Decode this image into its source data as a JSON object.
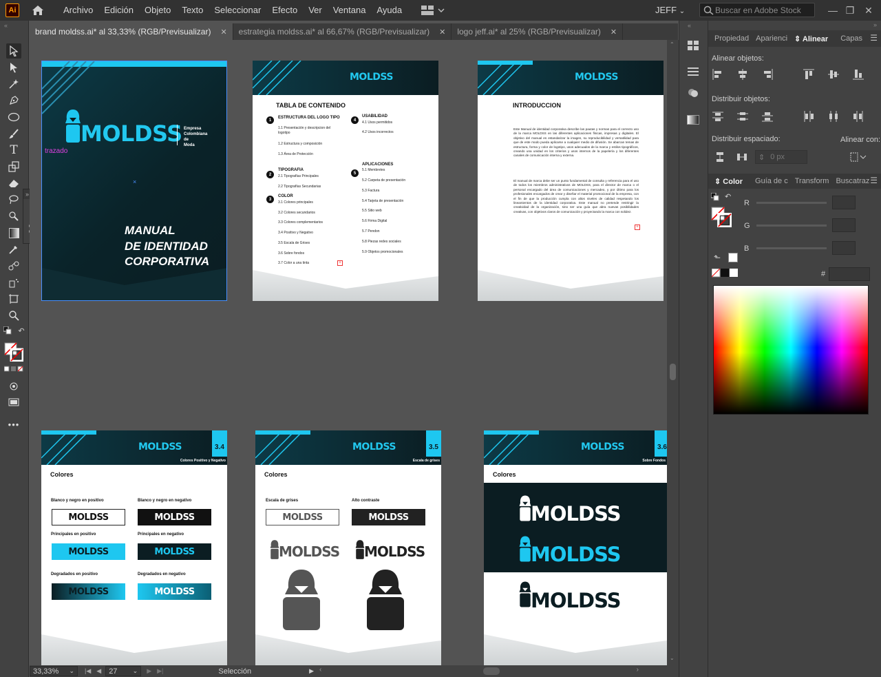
{
  "app": {
    "logo": "Ai",
    "user": "JEFF",
    "stock_search_placeholder": "Buscar en Adobe Stock"
  },
  "menu": [
    "Archivo",
    "Edición",
    "Objeto",
    "Texto",
    "Seleccionar",
    "Efecto",
    "Ver",
    "Ventana",
    "Ayuda"
  ],
  "tabs": [
    {
      "label": "brand moldss.ai* al 33,33% (RGB/Previsualizar)",
      "close": "✕"
    },
    {
      "label": "estrategia moldss.ai* al 66,67% (RGB/Previsualizar)",
      "close": "✕"
    },
    {
      "label": "logo jeff.ai* al 25% (RGB/Previsualizar)",
      "close": "✕"
    }
  ],
  "canvas": {
    "path_hint": "trazado",
    "cover": {
      "brand": "MOLDSS",
      "tagline": "Empresa\nColombiana\nde\nModa",
      "title1": "MANUAL",
      "title2": "DE IDENTIDAD",
      "title3": "CORPORATIVA"
    },
    "toc": {
      "brand": "MOLDSS",
      "title": "TABLA DE CONTENIDO",
      "s1": "ESTRUCTURA DEL LOGO TIPO",
      "s1_items": [
        "1.1 Presentación y descripcion del logotipo",
        "1.2 Estructura y composición",
        "1.3 Área de Protección"
      ],
      "s2": "TIPOGRAFIA",
      "s2_items": [
        "2.1 Tipografías Principales",
        "2.2 Tipografías Secundarias"
      ],
      "s3": "COLOR",
      "s3_items": [
        "3.1 Colores principales",
        "3.2 Colores secundarios",
        "3.3 Colores complementarios",
        "3.4 Positivo y Negativo",
        "3.5 Escala de Grises",
        "3.6 Sobre fondos",
        "3.7 Color a una tinta"
      ],
      "s4": "USABILIDAD",
      "s4_items": [
        "4.1 Usos permitidos",
        "4.2 Usos incorrectos"
      ],
      "s5": "APLICACIONES",
      "s5_items": [
        "5.1 Membretes",
        "5.2 Carpeta de presentación",
        "5.3 Factura",
        "5.4 Tarjeta de presentación",
        "5.5 Sitio web",
        "5.6 Firma Digital",
        "5.7 Pendon",
        "5.8 Piezas redes sociales",
        "5.9 Objetos promocionales"
      ],
      "nums": [
        "1",
        "2",
        "3",
        "4",
        "5"
      ]
    },
    "intro": {
      "brand": "MOLDSS",
      "title": "INTRODUCCION",
      "p1": "Este Manual de identidad corporativa describe las pautas y normas para el correcto uso de la marca MOLDSS en las diferentes aplicaciones físicas, impresas y digitales. El objetivo del manual es estandarizar la imagen, su reproducibilidad y versatilidad para que de este modo pueda aplicarse a cualquier medio de difusión. Se abarcan temas de estructura, forma y color de logotipo, usos adecuados de la marca y estilos tipográficos, creando una unidad en los criterios y usos internos de la papelería y los diferentes canales de comunicación interna y externa.",
      "p2": "El manual de marca debe ser un punto fundamental de consulta y referencia para el uso de todos los miembros administrativos de MOLDSS, para el director de marca o el personal encargado del área de comunicaciones y mercadeo, y por último para los profesionales encargados de crear y diseñar el material promocional de la empresa, con el fin de que la producción cumpla con altos niveles de calidad respetando los lineamientos de la identidad corporativa. Este manual no pretende restringir la creatividad de la organización, sino ser una guía que abra nuevas posibilidades creativas, con objetivos claros de comunicación y proyectando la marca con solidez."
    },
    "p34": {
      "brand": "MOLDSS",
      "num": "3.4",
      "sub": "Colores Positivo y Negativo",
      "section": "Colores",
      "l1": "Blanco y negro en positivo",
      "l2": "Blanco y negro en negativo",
      "l3": "Principales en positivo",
      "l4": "Principales en negativo",
      "l5": "Degradados en positivo",
      "l6": "Degradados en negativo",
      "logo": "MOLDSS"
    },
    "p35": {
      "brand": "MOLDSS",
      "num": "3.5",
      "sub": "Escala de grises",
      "section": "Colores",
      "l1": "Escala de grises",
      "l2": "Alto contraste",
      "logo": "MOLDSS"
    },
    "p36": {
      "brand": "MOLDSS",
      "num": "3.6",
      "sub": "Sobre Fondos",
      "section": "Colores",
      "logo": "MOLDSS"
    }
  },
  "right_panel": {
    "tabs": [
      "Propiedad",
      "Aparienci",
      "Alinear",
      "Capas"
    ],
    "align_objects": "Alinear objetos:",
    "distribute_objects": "Distribuir objetos:",
    "distribute_spacing": "Distribuir espaciado:",
    "align_to": "Alinear con:",
    "spacing_value": "0 px",
    "color_tabs": [
      "Color",
      "Guía de c",
      "Transform",
      "Buscatraz"
    ],
    "r": "R",
    "g": "G",
    "b": "B",
    "hash": "#"
  },
  "status": {
    "zoom": "33,33%",
    "page": "27",
    "tool": "Selección"
  },
  "colors": {
    "accent": "#1ec7f0",
    "dark": "#0b1d22"
  }
}
